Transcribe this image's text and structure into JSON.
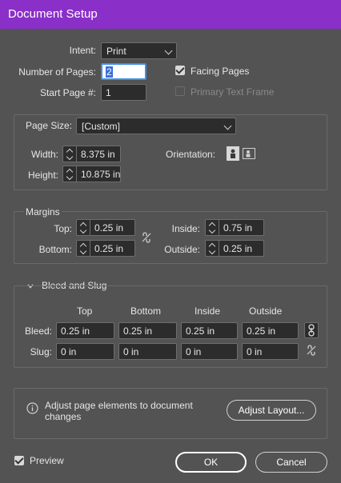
{
  "title": "Document Setup",
  "intent": {
    "label": "Intent:",
    "value": "Print"
  },
  "pages": {
    "label": "Number of Pages:",
    "value": "2"
  },
  "start_page": {
    "label": "Start Page #:",
    "value": "1"
  },
  "facing_pages": {
    "label": "Facing Pages",
    "checked": true
  },
  "primary_text_frame": {
    "label": "Primary Text Frame",
    "checked": false
  },
  "page_size": {
    "label": "Page Size:",
    "value": "[Custom]",
    "width_label": "Width:",
    "width": "8.375 in",
    "height_label": "Height:",
    "height": "10.875 in",
    "orientation_label": "Orientation:"
  },
  "margins": {
    "legend": "Margins",
    "top_label": "Top:",
    "top": "0.25 in",
    "bottom_label": "Bottom:",
    "bottom": "0.25 in",
    "inside_label": "Inside:",
    "inside": "0.75 in",
    "outside_label": "Outside:",
    "outside": "0.25 in"
  },
  "bleed_slug": {
    "legend": "Bleed and Slug",
    "columns": [
      "Top",
      "Bottom",
      "Inside",
      "Outside"
    ],
    "bleed_label": "Bleed:",
    "bleed": [
      "0.25 in",
      "0.25 in",
      "0.25 in",
      "0.25 in"
    ],
    "slug_label": "Slug:",
    "slug": [
      "0 in",
      "0 in",
      "0 in",
      "0 in"
    ]
  },
  "info": {
    "text": "Adjust page elements to document changes",
    "button": "Adjust Layout..."
  },
  "preview": {
    "label": "Preview",
    "checked": true
  },
  "ok_label": "OK",
  "cancel_label": "Cancel",
  "colors": {
    "titlebar": "#8a2fc8",
    "panel": "#535353",
    "field": "#2c2c2c",
    "focus": "#3d8fe8"
  }
}
